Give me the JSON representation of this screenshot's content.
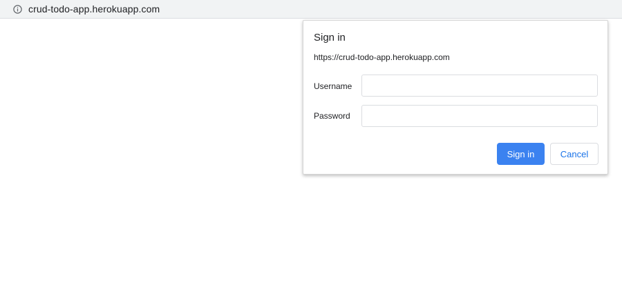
{
  "browser": {
    "url": "crud-todo-app.herokuapp.com",
    "url_icon": "info-icon"
  },
  "dialog": {
    "title": "Sign in",
    "origin": "https://crud-todo-app.herokuapp.com",
    "username_label": "Username",
    "username_value": "",
    "password_label": "Password",
    "password_value": "",
    "sign_in_label": "Sign in",
    "cancel_label": "Cancel"
  },
  "colors": {
    "primary_button": "#3b82f0",
    "link_blue": "#1a73e8",
    "address_bar": "#f1f3f4"
  }
}
